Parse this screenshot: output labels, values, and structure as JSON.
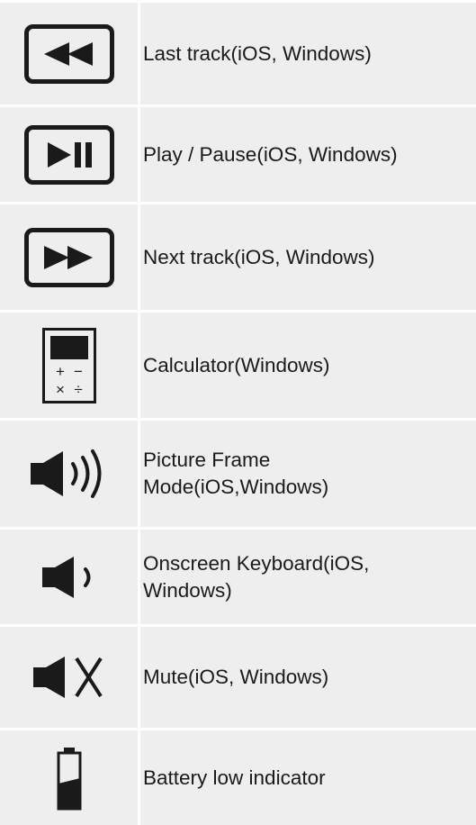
{
  "rows": [
    {
      "icon": "previous-track-icon",
      "label": "Last track(iOS, Windows)"
    },
    {
      "icon": "play-pause-icon",
      "label": "Play / Pause(iOS, Windows)"
    },
    {
      "icon": "next-track-icon",
      "label": "Next track(iOS, Windows)"
    },
    {
      "icon": "calculator-icon",
      "label": "Calculator(Windows)",
      "calculator_symbols": [
        "+",
        "−",
        "×",
        "÷"
      ]
    },
    {
      "icon": "volume-up-icon",
      "label": "Picture Frame\nMode(iOS,Windows)"
    },
    {
      "icon": "volume-down-icon",
      "label": "Onscreen Keyboard(iOS,\nWindows)"
    },
    {
      "icon": "mute-icon",
      "label": "Mute(iOS, Windows)"
    },
    {
      "icon": "battery-low-icon",
      "label": "Battery low indicator"
    }
  ],
  "colors": {
    "cell_background": "#eeeeee",
    "border": "#ffffff",
    "ink": "#1a1a1a"
  }
}
